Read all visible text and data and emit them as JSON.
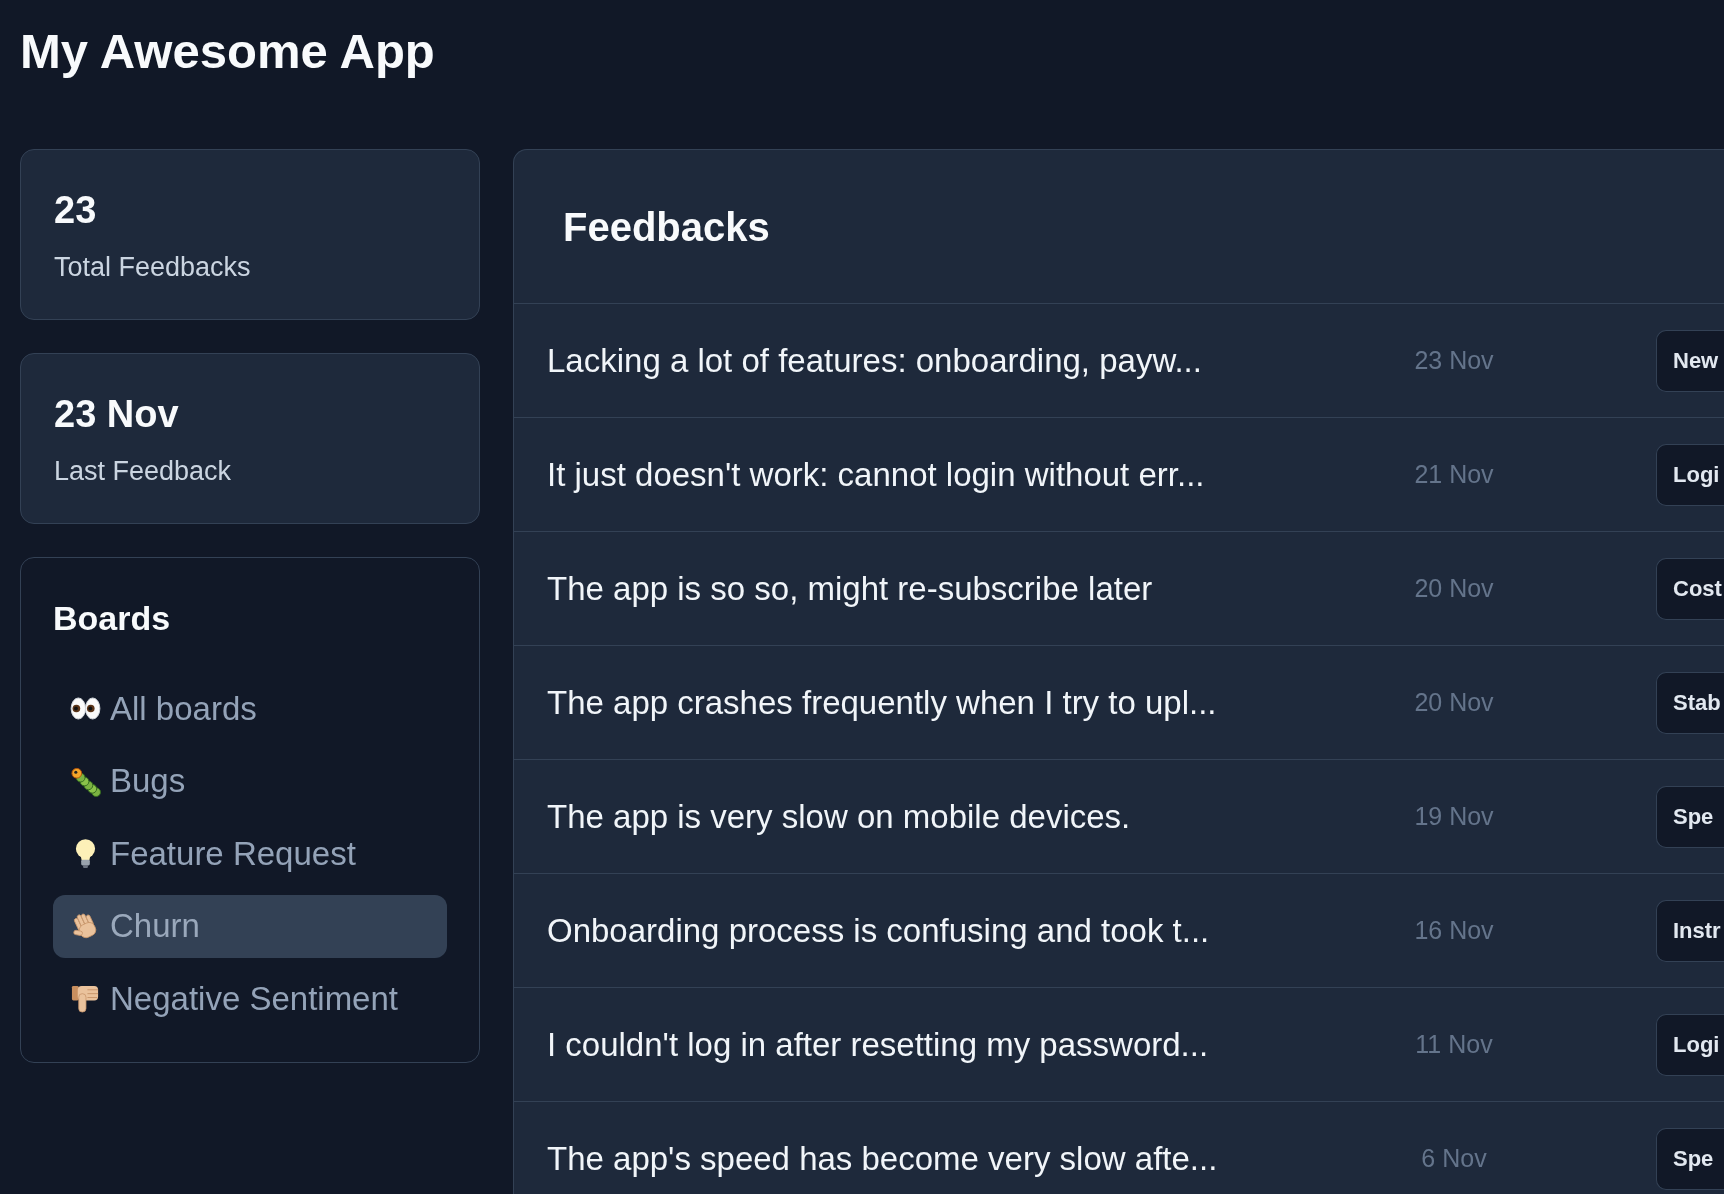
{
  "app": {
    "title": "My Awesome App"
  },
  "stats": [
    {
      "value": "23",
      "label": "Total Feedbacks"
    },
    {
      "value": "23 Nov",
      "label": "Last Feedback"
    }
  ],
  "boards": {
    "title": "Boards",
    "items": [
      {
        "label": "All boards",
        "selected": false
      },
      {
        "label": "Bugs",
        "selected": false
      },
      {
        "label": "Feature Request",
        "selected": false
      },
      {
        "label": "Churn",
        "selected": true
      },
      {
        "label": "Negative Sentiment",
        "selected": false
      }
    ]
  },
  "feedbacks": {
    "title": "Feedbacks",
    "rows": [
      {
        "text": "Lacking a lot of features: onboarding, payw...",
        "date": "23 Nov",
        "tag": "New"
      },
      {
        "text": "It just doesn't work: cannot login without err...",
        "date": "21 Nov",
        "tag": "Logi"
      },
      {
        "text": "The app is so so, might re-subscribe later",
        "date": "20 Nov",
        "tag": "Cost"
      },
      {
        "text": "The app crashes frequently when I try to upl...",
        "date": "20 Nov",
        "tag": "Stab"
      },
      {
        "text": "The app is very slow on mobile devices.",
        "date": "19 Nov",
        "tag": "Spe"
      },
      {
        "text": "Onboarding process is confusing and took t...",
        "date": "16 Nov",
        "tag": "Instr"
      },
      {
        "text": "I couldn't log in after resetting my password...",
        "date": "11 Nov",
        "tag": "Logi"
      },
      {
        "text": "The app's speed has become very slow afte...",
        "date": "6 Nov",
        "tag": "Spe"
      }
    ]
  }
}
